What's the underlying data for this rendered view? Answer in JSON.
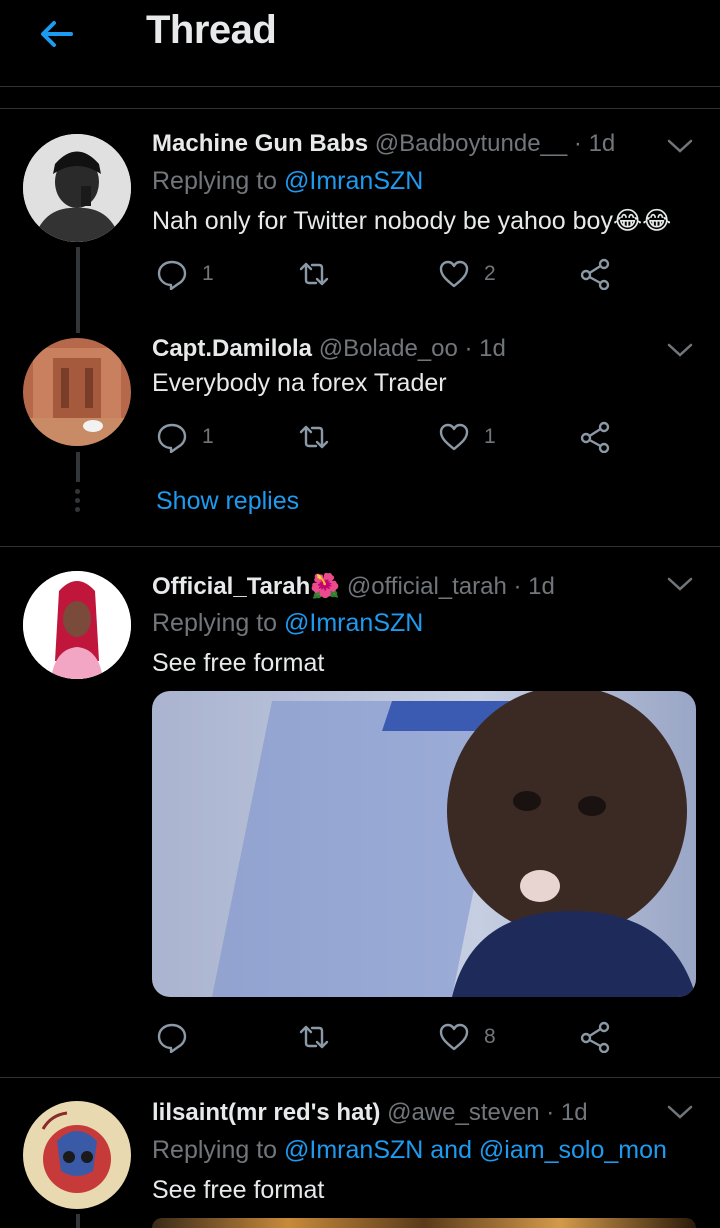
{
  "header": {
    "title": "Thread",
    "back_icon": "arrow-left-icon"
  },
  "colors": {
    "accent": "#1d9bf0",
    "muted": "#71767b",
    "text": "#e7e9ea",
    "bg": "#000000"
  },
  "tweets": [
    {
      "name": "Machine Gun Babs",
      "handle": "@Badboytunde__",
      "time": "· 1d",
      "replying_prefix": "Replying to ",
      "replying_to": "@ImranSZN",
      "text": "Nah only for Twitter nobody be yahoo boy😂😂",
      "replies": "1",
      "retweets": "",
      "likes": "2"
    },
    {
      "name": "Capt.Damilola",
      "handle": "@Bolade_oo",
      "time": "· 1d",
      "text": "Everybody na forex Trader",
      "replies": "1",
      "retweets": "",
      "likes": "1"
    },
    {
      "name": "Official_Tarah🌺",
      "handle": "@official_tarah",
      "time": "· 1d",
      "replying_prefix": "Replying to ",
      "replying_to": "@ImranSZN",
      "text": "See free format",
      "replies": "",
      "retweets": "",
      "likes": "8"
    },
    {
      "name": "lilsaint(mr red's hat)",
      "handle": "@awe_steven",
      "time": "· 1d",
      "replying_prefix": "Replying to ",
      "replying_to": "@ImranSZN and @iam_solo_mon",
      "text": "See free format"
    }
  ],
  "show_replies": "Show replies",
  "icons": {
    "reply": "reply-icon",
    "retweet": "retweet-icon",
    "like": "heart-icon",
    "share": "share-icon",
    "more": "chevron-down-icon"
  }
}
